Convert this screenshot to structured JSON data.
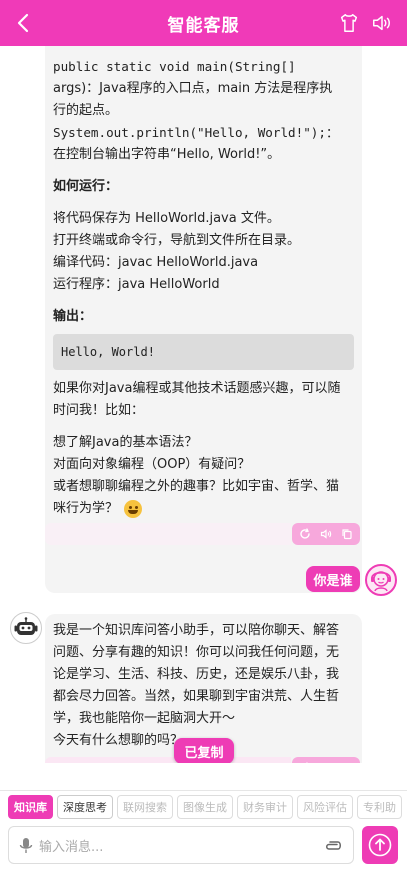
{
  "header": {
    "title": "智能客服",
    "accent_color": "#f03ab8"
  },
  "bot_message_1": {
    "lines": [
      "public static void main(String[]",
      "args)：Java程序的入口点，main 方法是程序执",
      "行的起点。",
      "System.out.println(\"Hello, World!\");：",
      "在控制台输出字符串“Hello, World!”。"
    ],
    "how_to_run_title": "如何运行：",
    "how_to_run_lines": [
      "将代码保存为 HelloWorld.java 文件。",
      "打开终端或命令行，导航到文件所在目录。",
      "编译代码：javac HelloWorld.java",
      "运行程序：java HelloWorld"
    ],
    "output_title": "输出：",
    "output_code": "Hello, World!",
    "followup_lines": [
      "如果你对Java编程或其他技术话题感兴趣，可以随",
      "时问我！比如："
    ],
    "suggestion_lines": [
      "想了解Java的基本语法？",
      "对面向对象编程（OOP）有疑问？",
      "或者想聊聊编程之外的趣事？比如宇宙、哲学、猫",
      "咪行为学？"
    ]
  },
  "user_message": {
    "text": "你是谁"
  },
  "bot_message_2": {
    "lines": [
      "我是一个知识库问答小助手，可以陪你聊天、解答",
      "问题、分享有趣的知识！你可以问我任何问题，无",
      "论是学习、生活、科技、历史，还是娱乐八卦，我",
      "都会尽力回答。当然，如果聊到宇宙洪荒、人生哲",
      "学，我也能陪你一起脑洞大开～",
      "今天有什么想聊的吗？"
    ]
  },
  "toast": {
    "text": "已复制"
  },
  "toolbar": {
    "chips": [
      "知识库",
      "深度思考",
      "联网搜索",
      "图像生成",
      "财务审计",
      "风险评估",
      "专利助"
    ]
  },
  "input": {
    "placeholder": "输入消息..."
  },
  "icons": {
    "back": "chevron-left-icon",
    "shirt": "shirt-icon",
    "speaker": "speaker-icon",
    "refresh": "refresh-icon",
    "read_aloud": "speaker-icon",
    "copy": "copy-icon",
    "mic": "microphone-icon",
    "attach": "paperclip-icon",
    "send": "arrow-up-icon"
  }
}
